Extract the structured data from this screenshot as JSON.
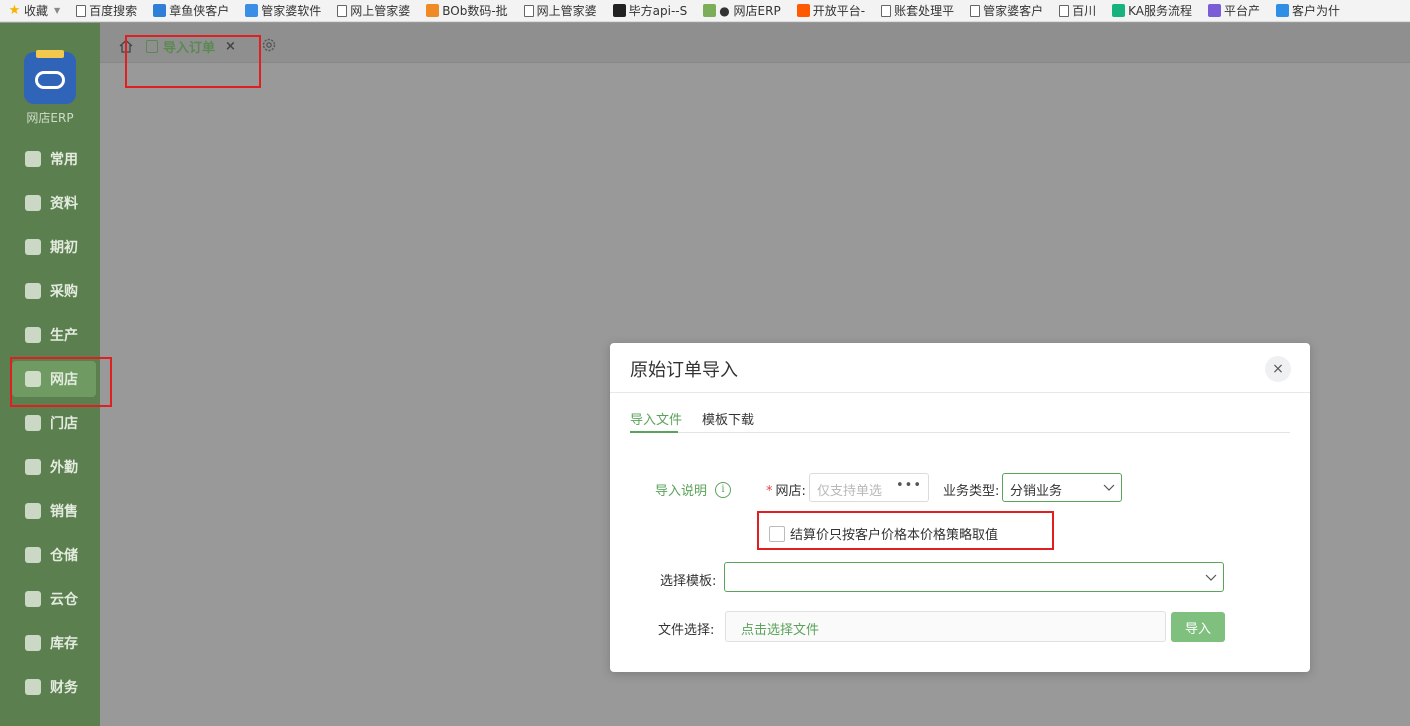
{
  "bookmarks": [
    {
      "label": "收藏",
      "icon": "star-icon",
      "color": "#f5b400"
    },
    {
      "label": "百度搜索",
      "icon": "doc-icon"
    },
    {
      "label": "章鱼侠客户",
      "icon": "octopus-icon",
      "color": "#2f7fd8"
    },
    {
      "label": "管家婆软件",
      "icon": "cloud-icon",
      "color": "#3a8ee6"
    },
    {
      "label": "网上管家婆",
      "icon": "doc-icon"
    },
    {
      "label": "BOb数码-批",
      "icon": "cloud-orange-icon",
      "color": "#f08a24"
    },
    {
      "label": "网上管家婆",
      "icon": "doc-icon"
    },
    {
      "label": "毕方api--S",
      "icon": "feather-icon",
      "color": "#222222"
    },
    {
      "label": "● 网店ERP",
      "icon": "erp-icon",
      "color": "#7cae5a"
    },
    {
      "label": "开放平台-",
      "icon": "taobao-icon",
      "color": "#ff5a00"
    },
    {
      "label": "账套处理平",
      "icon": "doc-icon"
    },
    {
      "label": "管家婆客户",
      "icon": "doc-icon"
    },
    {
      "label": "百川",
      "icon": "doc-icon"
    },
    {
      "label": "KA服务流程",
      "icon": "ka-icon",
      "color": "#16b37e"
    },
    {
      "label": "平台产",
      "icon": "k-icon",
      "color": "#7a5cd6"
    },
    {
      "label": "客户为什",
      "icon": "bot-icon",
      "color": "#2f8ee6"
    }
  ],
  "sidebar": {
    "app_name": "网店ERP",
    "items": [
      {
        "label": "常用",
        "icon": "star-icon"
      },
      {
        "label": "资料",
        "icon": "document-icon"
      },
      {
        "label": "期初",
        "icon": "target-icon"
      },
      {
        "label": "采购",
        "icon": "purchase-icon"
      },
      {
        "label": "生产",
        "icon": "production-icon"
      },
      {
        "label": "网店",
        "icon": "store-icon",
        "active": true
      },
      {
        "label": "门店",
        "icon": "pie-icon"
      },
      {
        "label": "外勤",
        "icon": "field-icon"
      },
      {
        "label": "销售",
        "icon": "sales-icon"
      },
      {
        "label": "仓储",
        "icon": "warehouse-icon"
      },
      {
        "label": "云仓",
        "icon": "cloud-warehouse-icon"
      },
      {
        "label": "库存",
        "icon": "inventory-icon"
      },
      {
        "label": "财务",
        "icon": "finance-icon"
      }
    ]
  },
  "tabbar": {
    "active_tab": "导入订单",
    "close_symbol": "×"
  },
  "modal": {
    "title": "原始订单导入",
    "close_symbol": "×",
    "tabs": [
      {
        "label": "导入文件",
        "active": true
      },
      {
        "label": "模板下载",
        "active": false
      }
    ],
    "help_link": "导入说明",
    "help_icon_glyph": "i",
    "shop_label": "网店:",
    "required_mark": "*",
    "shop_placeholder": "仅支持单选",
    "shop_dots": "•••",
    "biz_type_label": "业务类型:",
    "biz_type_value": "分销业务",
    "checkbox_label": "结算价只按客户价格本价格策略取值",
    "checkbox_checked": false,
    "template_label": "选择模板:",
    "template_value": "",
    "file_label": "文件选择:",
    "file_placeholder": "点击选择文件",
    "import_button": "导入"
  },
  "colors": {
    "sidebar_bg": "#5b7f4f",
    "accent": "#5aa35a",
    "annotation": "#e02020",
    "overlay": "#999999"
  }
}
